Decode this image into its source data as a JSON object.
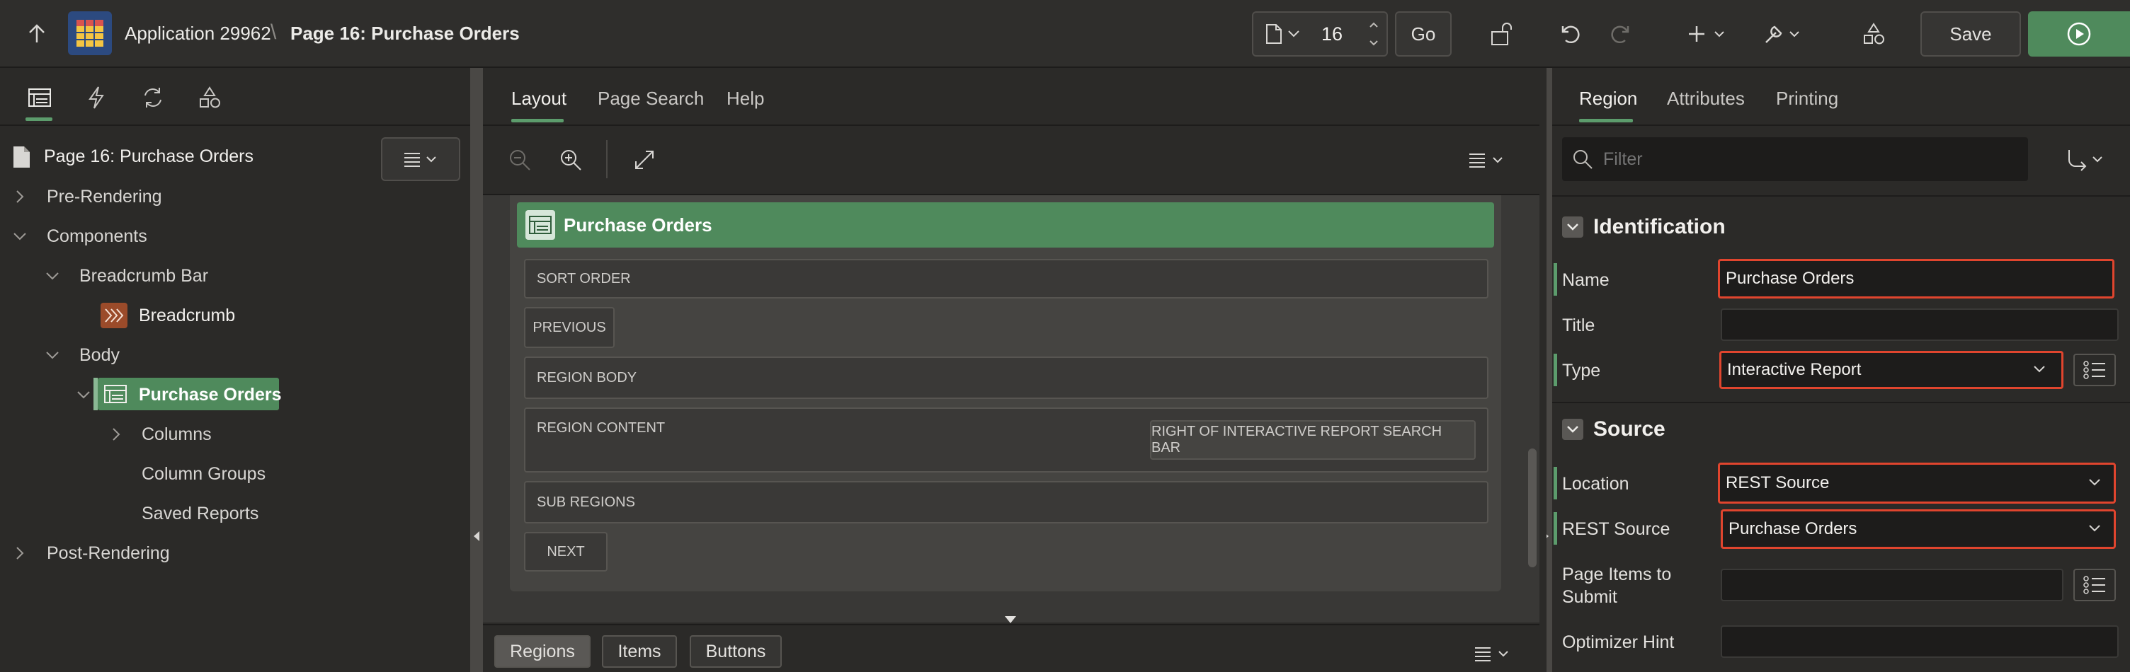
{
  "topbar": {
    "app_name": "Application 29962",
    "separator": "\\",
    "page_title": "Page 16: Purchase Orders",
    "page_number": "16",
    "go_label": "Go",
    "save_label": "Save"
  },
  "left": {
    "root": "Page 16: Purchase Orders",
    "items": [
      {
        "label": "Pre-Rendering"
      },
      {
        "label": "Components"
      },
      {
        "label": "Breadcrumb Bar"
      },
      {
        "label": "Breadcrumb"
      },
      {
        "label": "Body"
      },
      {
        "label": "Purchase Orders"
      },
      {
        "label": "Columns"
      },
      {
        "label": "Column Groups"
      },
      {
        "label": "Saved Reports"
      },
      {
        "label": "Post-Rendering"
      }
    ]
  },
  "middle": {
    "tabs": [
      "Layout",
      "Page Search",
      "Help"
    ],
    "region_title": "Purchase Orders",
    "slots": {
      "sort_order": "SORT ORDER",
      "previous": "PREVIOUS",
      "region_body": "REGION BODY",
      "region_content": "REGION CONTENT",
      "right_of_search": "RIGHT OF INTERACTIVE REPORT SEARCH BAR",
      "sub_regions": "SUB REGIONS",
      "next": "NEXT"
    },
    "bottom_tabs": [
      "Regions",
      "Items",
      "Buttons"
    ]
  },
  "right": {
    "tabs": [
      "Region",
      "Attributes",
      "Printing"
    ],
    "filter_placeholder": "Filter",
    "identification": {
      "title": "Identification",
      "name_label": "Name",
      "name_value": "Purchase Orders",
      "title_label": "Title",
      "title_value": "",
      "type_label": "Type",
      "type_value": "Interactive Report"
    },
    "source": {
      "title": "Source",
      "location_label": "Location",
      "location_value": "REST Source",
      "rest_label": "REST Source",
      "rest_value": "Purchase Orders",
      "items_label_1": "Page Items to",
      "items_label_2": "Submit",
      "hint_label": "Optimizer Hint"
    }
  },
  "colors": {
    "accent_green": "#5c9c6c",
    "highlight_red": "#e0452e",
    "region_header": "#4f8a5c"
  }
}
